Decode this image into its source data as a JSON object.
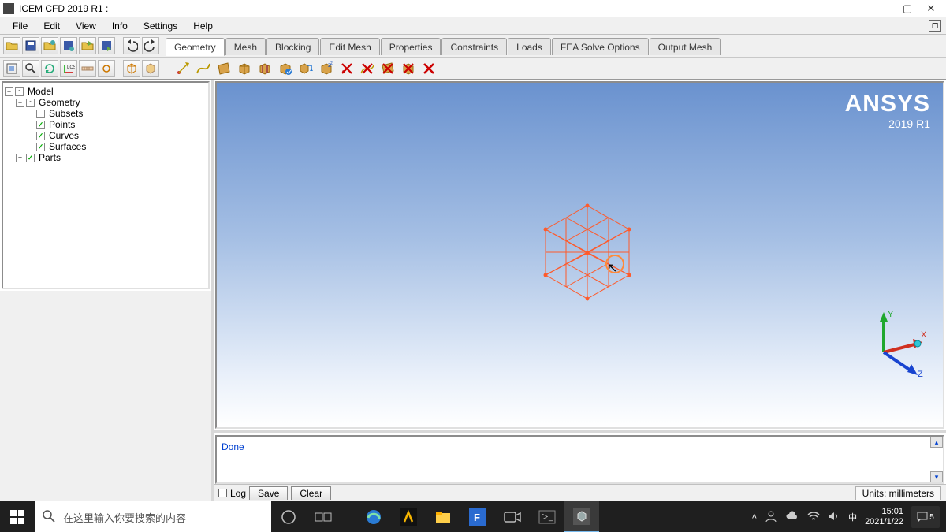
{
  "window": {
    "title": "ICEM CFD 2019 R1 :",
    "min": "—",
    "max": "▢",
    "close": "✕"
  },
  "menu": {
    "items": [
      "File",
      "Edit",
      "View",
      "Info",
      "Settings",
      "Help"
    ]
  },
  "tabs": {
    "items": [
      "Geometry",
      "Mesh",
      "Blocking",
      "Edit Mesh",
      "Properties",
      "Constraints",
      "Loads",
      "FEA Solve Options",
      "Output Mesh"
    ],
    "active": 0
  },
  "tree": {
    "root": "Model",
    "geometry": "Geometry",
    "subsets": "Subsets",
    "points": "Points",
    "curves": "Curves",
    "surfaces": "Surfaces",
    "parts": "Parts"
  },
  "brand": {
    "name": "ANSYS",
    "version": "2019 R1"
  },
  "triad": {
    "x": "X",
    "y": "Y",
    "z": "Z"
  },
  "message": {
    "text": "Done"
  },
  "logbar": {
    "log": "Log",
    "save": "Save",
    "clear": "Clear",
    "units": "Units: millimeters"
  },
  "taskbar": {
    "search_placeholder": "在这里输入你要搜索的内容",
    "ime": "中",
    "time": "15:01",
    "date": "2021/1/22",
    "notif_count": "5"
  },
  "colors": {
    "wire": "#ff5a2a",
    "axis_x": "#d03020",
    "axis_y": "#20a82e",
    "axis_z": "#1844d0"
  }
}
